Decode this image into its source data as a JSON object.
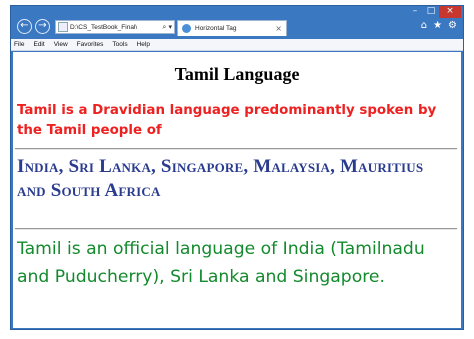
{
  "browser": {
    "address": "D:\\CS_TestBook_Final\\",
    "address_search_glyph": "⌕ ▾",
    "back_glyph": "←",
    "forward_glyph": "→",
    "tab_title": "Horizontal Tag",
    "tab_close_glyph": "×",
    "caption": {
      "minimize": "–",
      "maximize": "□",
      "close": "×"
    },
    "right_icons": {
      "home": "⌂",
      "favorites": "★",
      "tools": "⚙"
    },
    "menu": [
      "File",
      "Edit",
      "View",
      "Favorites",
      "Tools",
      "Help"
    ]
  },
  "page": {
    "heading": "Tamil Language",
    "red_paragraph": "Tamil is a Dravidian language predominantly spoken by the Tamil people of",
    "blue_paragraph": "India, Sri Lanka, Singapore, Malaysia, Mauritius and South Africa",
    "green_paragraph": "Tamil is an official language of India (Tamilnadu and Puducherry), Sri Lanka and Singapore."
  },
  "colors": {
    "window_frame": "#3b78c2",
    "red_text": "#ee2020",
    "blue_text": "#2b3c8f",
    "green_text": "#138a2c"
  }
}
